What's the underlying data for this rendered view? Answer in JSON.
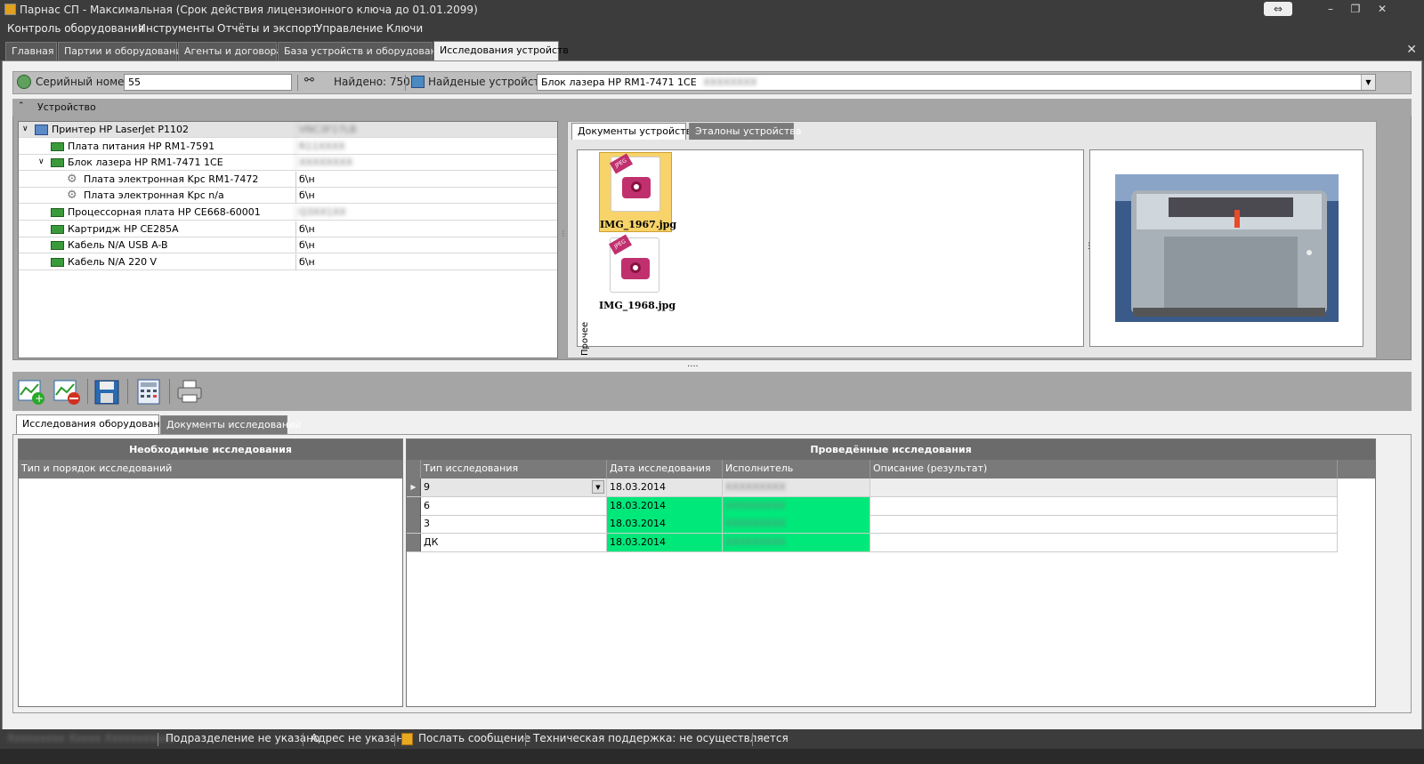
{
  "window": {
    "title": "Парнас СП - Максимальная (Срок действия лицензионного ключа до 01.01.2099)",
    "controls": [
      "⇔",
      "–",
      "❐",
      "✕"
    ]
  },
  "menu": [
    "Контроль оборудования",
    "Инструменты",
    "Отчёты и экспорт",
    "Управление",
    "Ключи"
  ],
  "main_tabs": [
    "Главная",
    "Партии и оборудование",
    "Агенты и договора",
    "База устройств и оборудования",
    "Исследования устройств"
  ],
  "active_main_tab": "Исследования устройств",
  "search": {
    "serial_label": "Серийный номер",
    "serial_value": "55",
    "found_label": "Найдено: 750",
    "found_devices_label": "Найденые устройства",
    "selected_device": "Блок лазера HP RM1-7471 1CE",
    "selected_device_serial": "XXXXXXXX"
  },
  "device_panel": {
    "header": "Устройство",
    "tree": [
      {
        "name": "Принтер  HP LaserJet P1102",
        "value": "VNC3F17LB",
        "blur": true,
        "level": 0,
        "expand": "∨",
        "icon": "printer-icon"
      },
      {
        "name": "Плата питания  HP RM1-7591",
        "value": "R11XXXX",
        "blur": true,
        "level": 1,
        "expand": "",
        "icon": "board-icon"
      },
      {
        "name": "Блок лазера  HP RM1-7471 1CE",
        "value": "XXXXXXXX",
        "blur": true,
        "level": 1,
        "expand": "∨",
        "icon": "board-icon"
      },
      {
        "name": "Плата электронная  Kpc RM1-7472",
        "value": "б\\н",
        "blur": false,
        "level": 2,
        "expand": "",
        "icon": "gear-icon"
      },
      {
        "name": "Плата электронная  Kpc n/a",
        "value": "б\\н",
        "blur": false,
        "level": 2,
        "expand": "",
        "icon": "gear-icon"
      },
      {
        "name": "Процессорная плата  HP CE668-60001",
        "value": "Q3XX1XX",
        "blur": true,
        "level": 1,
        "expand": "",
        "icon": "board-icon"
      },
      {
        "name": "Картридж  HP CE285A",
        "value": "б\\н",
        "blur": false,
        "level": 1,
        "expand": "",
        "icon": "board-icon"
      },
      {
        "name": "Кабель  N/A USB A-B",
        "value": "б\\н",
        "blur": false,
        "level": 1,
        "expand": "",
        "icon": "board-icon"
      },
      {
        "name": "Кабель  N/A 220 V",
        "value": "б\\н",
        "blur": false,
        "level": 1,
        "expand": "",
        "icon": "board-icon"
      }
    ],
    "doc_tabs": [
      "Документы устройства",
      "Эталоны устройства"
    ],
    "active_doc_tab": "Документы устройства",
    "documents": [
      {
        "name": "IMG_1967.jpg",
        "selected": true
      },
      {
        "name": "IMG_1968.jpg",
        "selected": false
      }
    ],
    "group_label": "Прочее",
    "splitter": "····"
  },
  "toolbar2": [
    "add-study-icon",
    "remove-study-icon",
    "save-icon",
    "calculator-icon",
    "print-icon"
  ],
  "bottom_tabs": [
    "Исследования оборудования",
    "Документы исследований"
  ],
  "active_bottom_tab": "Исследования оборудования",
  "required_studies": {
    "title": "Необходимые исследования",
    "column": "Тип и порядок исследований"
  },
  "done_studies": {
    "title": "Проведённые исследования",
    "columns": [
      "Тип исследования",
      "Дата исследования",
      "Исполнитель",
      "Описание (результат)"
    ],
    "rows": [
      {
        "type": "9",
        "date": "18.03.2014",
        "executor": "XXXXXXXXX",
        "description": "",
        "green": false,
        "current": true
      },
      {
        "type": "6",
        "date": "18.03.2014",
        "executor": "XXXXXXXXX",
        "description": "",
        "green": true,
        "current": false
      },
      {
        "type": "3",
        "date": "18.03.2014",
        "executor": "XXXXXXXXX",
        "description": "",
        "green": true,
        "current": false
      },
      {
        "type": "ДК",
        "date": "18.03.2014",
        "executor": "XXXXXXXXX",
        "description": "",
        "green": true,
        "current": false
      }
    ]
  },
  "status": {
    "user": "Xxxxxxxxx Xxxxx Xxxxxxxxxxx",
    "department": "Подразделение не указано",
    "address": "Адрес не указан",
    "message": "Послать сообщение",
    "support": "Техническая поддержка: не осуществляется"
  },
  "colors": {
    "green_highlight": "#00e87a",
    "selected_doc": "#f7d36a",
    "chrome": "#3c3c3c"
  }
}
